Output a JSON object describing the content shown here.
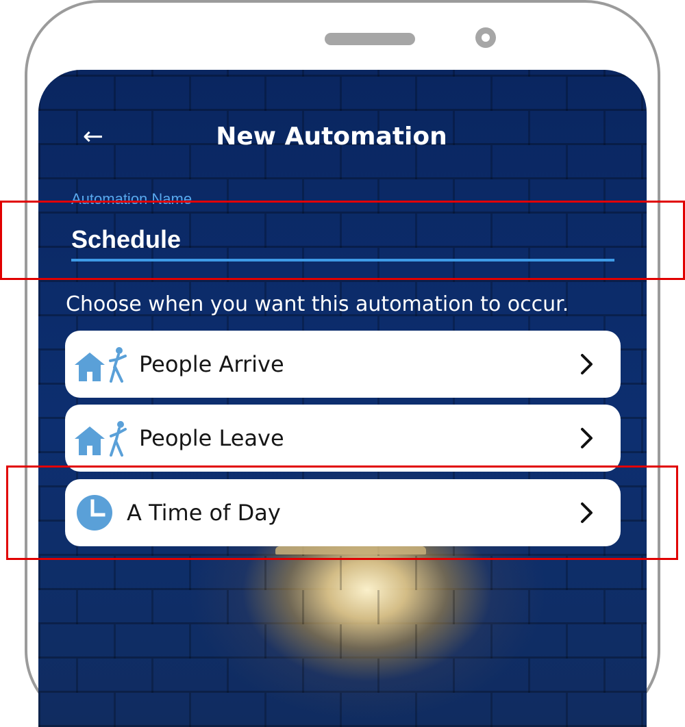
{
  "header": {
    "back_label": "←",
    "title": "New Automation"
  },
  "automation_name": {
    "label": "Automation Name",
    "value": "Schedule"
  },
  "prompt": "Choose when you want this automation to occur.",
  "options": [
    {
      "label": "People Arrive",
      "icon": "house-person-arrive-icon"
    },
    {
      "label": "People Leave",
      "icon": "house-person-leave-icon"
    },
    {
      "label": "A Time of Day",
      "icon": "clock-icon"
    }
  ],
  "colors": {
    "accent": "#3e9be7",
    "icon": "#5aa0d8",
    "highlight": "#e10000",
    "background": "#0b2a66"
  }
}
